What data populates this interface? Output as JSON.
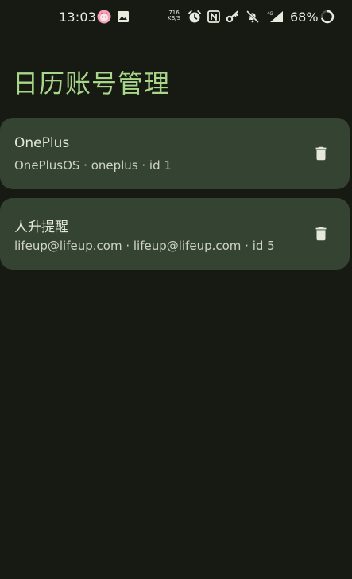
{
  "status_bar": {
    "time": "13:03",
    "net_speed_value": "716",
    "net_speed_unit": "KB/S",
    "signal_label": "4G",
    "battery": "68%",
    "icons": [
      "app-notification-icon",
      "image-icon",
      "alarm-icon",
      "nfc-icon",
      "key-icon",
      "mute-icon",
      "signal-icon",
      "battery-ring-icon"
    ]
  },
  "page": {
    "title": "日历账号管理"
  },
  "accounts": [
    {
      "name": "OnePlus",
      "detail": "OnePlusOS · oneplus · id 1",
      "delete_icon": "trash-icon"
    },
    {
      "name": "人升提醒",
      "detail": "lifeup@lifeup.com · lifeup@lifeup.com · id 5",
      "delete_icon": "trash-icon"
    }
  ],
  "colors": {
    "background": "#171a13",
    "card": "#354332",
    "title": "#a8d78a",
    "text": "#e5e8dc"
  }
}
